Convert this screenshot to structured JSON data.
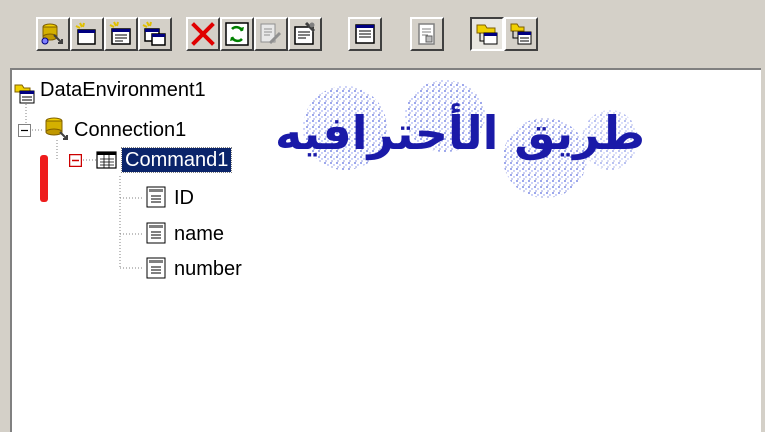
{
  "tree": {
    "root_label": "DataEnvironment1",
    "connection_label": "Connection1",
    "command_label": "Command1",
    "fields": [
      {
        "label": "ID"
      },
      {
        "label": "name"
      },
      {
        "label": "number"
      }
    ]
  },
  "overlay": {
    "arabic_text": "طريق الأحترافيه"
  },
  "icons": {
    "toolbar": [
      "add-connection-icon",
      "add-command-icon",
      "insert-stored-procedures-icon",
      "add-child-command-icon",
      "delete-icon",
      "refresh-icon",
      "design-icon",
      "properties-icon",
      "view-code-icon",
      "arrange-by-connections-icon",
      "arrange-by-objects-icon",
      "expand-icon"
    ]
  },
  "colors": {
    "selection": "#0a246a",
    "marker": "#ee1c1c",
    "overlay_text": "#1a1aa8"
  }
}
